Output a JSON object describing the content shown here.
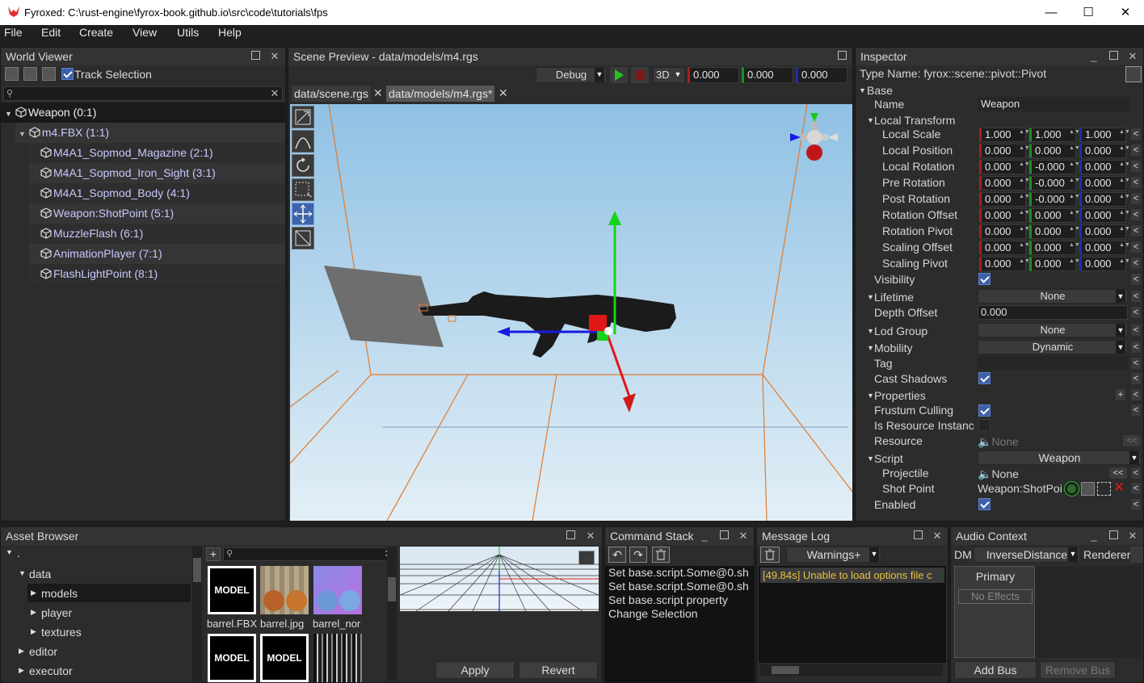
{
  "window": {
    "title": "Fyroxed: C:\\rust-engine\\fyrox-book.github.io\\src\\code\\tutorials\\fps",
    "minimize": "—",
    "maximize": "☐",
    "close": "✕"
  },
  "menu": [
    "File",
    "Edit",
    "Create",
    "View",
    "Utils",
    "Help"
  ],
  "world_viewer": {
    "title": "World Viewer",
    "track_selection": "Track Selection",
    "tree": [
      "Weapon (0:1)",
      "m4.FBX (1:1)",
      "M4A1_Sopmod_Magazine (2:1)",
      "M4A1_Sopmod_Iron_Sight (3:1)",
      "M4A1_Sopmod_Body (4:1)",
      "Weapon:ShotPoint (5:1)",
      "MuzzleFlash (6:1)",
      "AnimationPlayer (7:1)",
      "FlashLightPoint (8:1)"
    ]
  },
  "scene_preview": {
    "title": "Scene Preview - data/models/m4.rgs",
    "mode": "Debug",
    "view": "3D",
    "cam_x": "0.000",
    "cam_y": "0.000",
    "cam_z": "0.000",
    "tabs": [
      "data/scene.rgs",
      "data/models/m4.rgs*"
    ]
  },
  "inspector": {
    "title": "Inspector",
    "type_name": "Type Name: fyrox::scene::pivot::Pivot",
    "base": "Base",
    "name_label": "Name",
    "name_value": "Weapon",
    "local_transform": "Local Transform",
    "vec_rows": [
      {
        "label": "Local Scale",
        "x": "1.000",
        "y": "1.000",
        "z": "1.000"
      },
      {
        "label": "Local Position",
        "x": "0.000",
        "y": "0.000",
        "z": "0.000"
      },
      {
        "label": "Local Rotation",
        "x": "0.000",
        "y": "-0.000",
        "z": "0.000"
      },
      {
        "label": "Pre Rotation",
        "x": "0.000",
        "y": "-0.000",
        "z": "0.000"
      },
      {
        "label": "Post Rotation",
        "x": "0.000",
        "y": "-0.000",
        "z": "0.000"
      },
      {
        "label": "Rotation Offset",
        "x": "0.000",
        "y": "0.000",
        "z": "0.000"
      },
      {
        "label": "Rotation Pivot",
        "x": "0.000",
        "y": "0.000",
        "z": "0.000"
      },
      {
        "label": "Scaling Offset",
        "x": "0.000",
        "y": "0.000",
        "z": "0.000"
      },
      {
        "label": "Scaling Pivot",
        "x": "0.000",
        "y": "0.000",
        "z": "0.000"
      }
    ],
    "visibility": "Visibility",
    "lifetime": "Lifetime",
    "lifetime_value": "None",
    "depth_offset": "Depth Offset",
    "depth_offset_value": "0.000",
    "lod_group": "Lod Group",
    "lod_group_value": "None",
    "mobility": "Mobility",
    "mobility_value": "Dynamic",
    "tag": "Tag",
    "cast_shadows": "Cast Shadows",
    "properties": "Properties",
    "frustum_culling": "Frustum Culling",
    "is_resource_instance": "Is Resource Instanc",
    "resource": "Resource",
    "resource_value": "None",
    "script": "Script",
    "script_value": "Weapon",
    "projectile": "Projectile",
    "projectile_value": "None",
    "shot_point": "Shot Point",
    "shot_point_value": "Weapon:ShotPoi",
    "enabled": "Enabled"
  },
  "asset_browser": {
    "title": "Asset Browser",
    "root": ".",
    "folders": [
      "data",
      "models",
      "player",
      "textures",
      "editor",
      "executor"
    ],
    "assets": [
      {
        "label": "barrel.FBX",
        "thumb": "MODEL"
      },
      {
        "label": "barrel.jpg",
        "thumb": ""
      },
      {
        "label": "barrel_nor",
        "thumb": ""
      },
      {
        "label": "",
        "thumb": "MODEL"
      },
      {
        "label": "",
        "thumb": "MODEL"
      }
    ],
    "apply": "Apply",
    "revert": "Revert"
  },
  "command_stack": {
    "title": "Command Stack",
    "items": [
      "Set base.script.Some@0.sh",
      "Set base.script.Some@0.sh",
      "Set base.script property",
      "Change Selection"
    ]
  },
  "message_log": {
    "title": "Message Log",
    "filter": "Warnings+",
    "messages": [
      "[49.84s] Unable to load options file c"
    ]
  },
  "audio_context": {
    "title": "Audio Context",
    "dm_label": "DM",
    "dm_value": "InverseDistance",
    "renderer_label": "Renderer",
    "bus": "Primary",
    "no_effects": "No Effects",
    "add_bus": "Add Bus",
    "remove_bus": "Remove Bus"
  },
  "colors": {
    "accent": "#3c5fa8",
    "selection": "#1a1a1a",
    "panel": "#2c2c2c",
    "warning_text": "#e8c040",
    "sky_top": "#93c4e6",
    "sky_bottom": "#e1eef6",
    "grid_orange": "#e07a2a"
  }
}
